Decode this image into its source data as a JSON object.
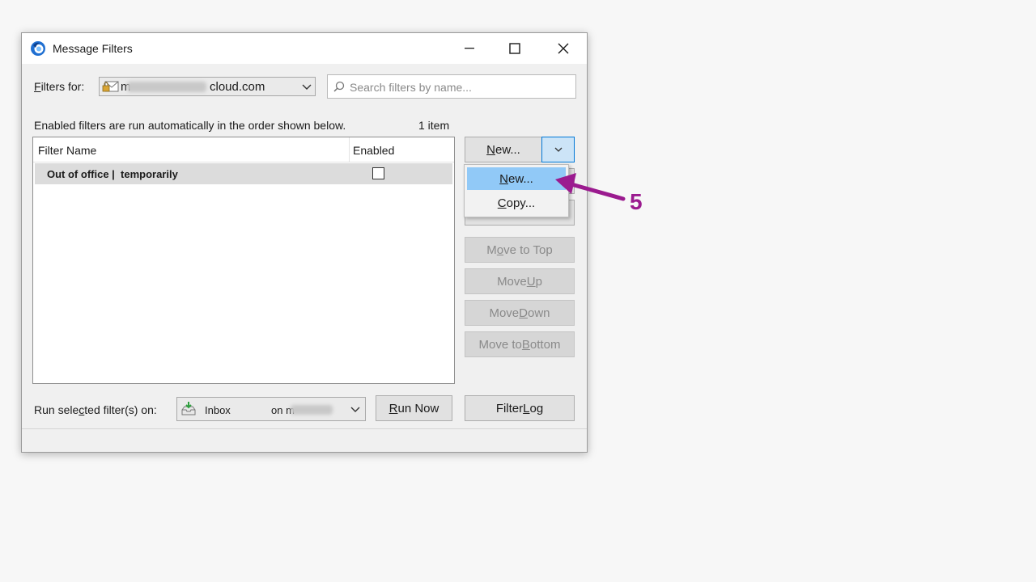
{
  "window": {
    "title": "Message Filters",
    "minimize_glyph": "—",
    "maximize_glyph": "☐",
    "close_glyph": "✕"
  },
  "filters_for": {
    "label_prefix": "",
    "label_underlined": "F",
    "label_suffix": "ilters for:",
    "account_start": "m",
    "account_suffix": "cloud.com"
  },
  "search": {
    "placeholder": "Search filters by name..."
  },
  "info": {
    "text": "Enabled filters are run automatically in the order shown below.",
    "count": "1 item"
  },
  "list": {
    "columns": {
      "name": "Filter Name",
      "enabled": "Enabled"
    },
    "rows": [
      {
        "name": "Out of office |  temporarily",
        "enabled": false
      }
    ]
  },
  "buttons": {
    "new_underlined": "N",
    "new_rest": "ew...",
    "move_top_pre": "M",
    "move_top_u": "o",
    "move_top_post": "ve to Top",
    "move_up_pre": "Move ",
    "move_up_u": "U",
    "move_up_post": "p",
    "move_down_pre": "Move ",
    "move_down_u": "D",
    "move_down_post": "own",
    "move_bottom_pre": "Move to ",
    "move_bottom_u": "B",
    "move_bottom_post": "ottom",
    "run_now_u": "R",
    "run_now_post": "un Now",
    "filter_log_pre": "Filter ",
    "filter_log_u": "L",
    "filter_log_post": "og"
  },
  "dropdown_menu": {
    "new_u": "N",
    "new_rest": "ew...",
    "copy_u": "C",
    "copy_rest": "opy..."
  },
  "run_on": {
    "label_pre": "Run sele",
    "label_u": "c",
    "label_post": "ted filter(s) on:",
    "folder": "Inbox",
    "on": "on m"
  },
  "annotation": {
    "step": "5",
    "color": "#9b1b8f"
  },
  "colors": {
    "accent_blue": "#0078d7",
    "selection": "#91c9f7"
  }
}
